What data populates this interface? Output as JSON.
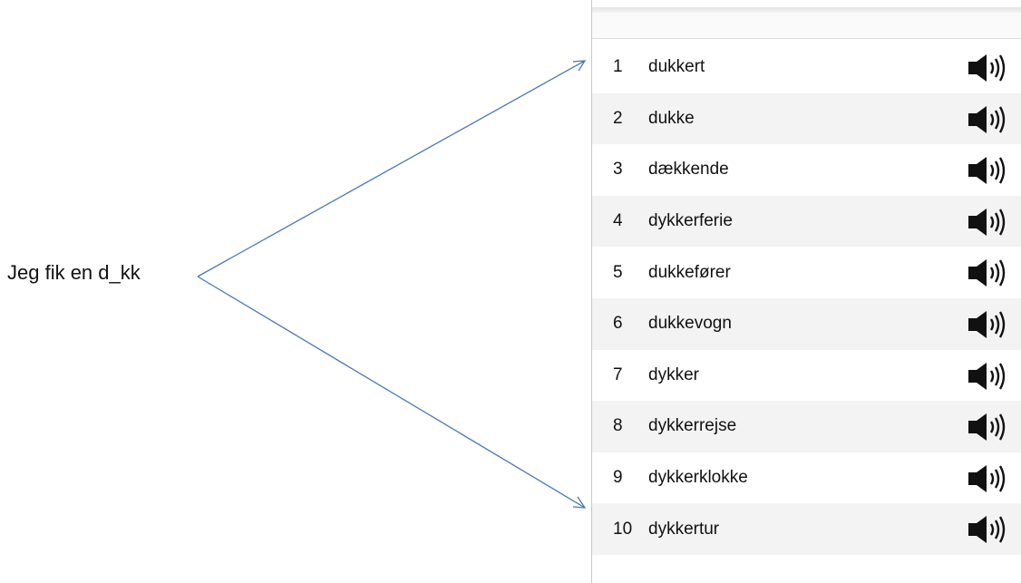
{
  "prompt": {
    "text": "Jeg fik en d_kk"
  },
  "suggestions": [
    {
      "number": "1",
      "word": "dukkert",
      "icon": "speaker-icon"
    },
    {
      "number": "2",
      "word": "dukke",
      "icon": "speaker-icon"
    },
    {
      "number": "3",
      "word": "dækkende",
      "icon": "speaker-icon"
    },
    {
      "number": "4",
      "word": "dykkerferie",
      "icon": "speaker-icon"
    },
    {
      "number": "5",
      "word": "dukkefører",
      "icon": "speaker-icon"
    },
    {
      "number": "6",
      "word": "dukkevogn",
      "icon": "speaker-icon"
    },
    {
      "number": "7",
      "word": "dykker",
      "icon": "speaker-icon"
    },
    {
      "number": "8",
      "word": "dykkerrejse",
      "icon": "speaker-icon"
    },
    {
      "number": "9",
      "word": "dykkerklokke",
      "icon": "speaker-icon"
    },
    {
      "number": "10",
      "word": "dykkertur",
      "icon": "speaker-icon"
    }
  ],
  "colors": {
    "arrow": "#4a78b5",
    "row_alt": "#f3f3f3",
    "text": "#111111"
  }
}
